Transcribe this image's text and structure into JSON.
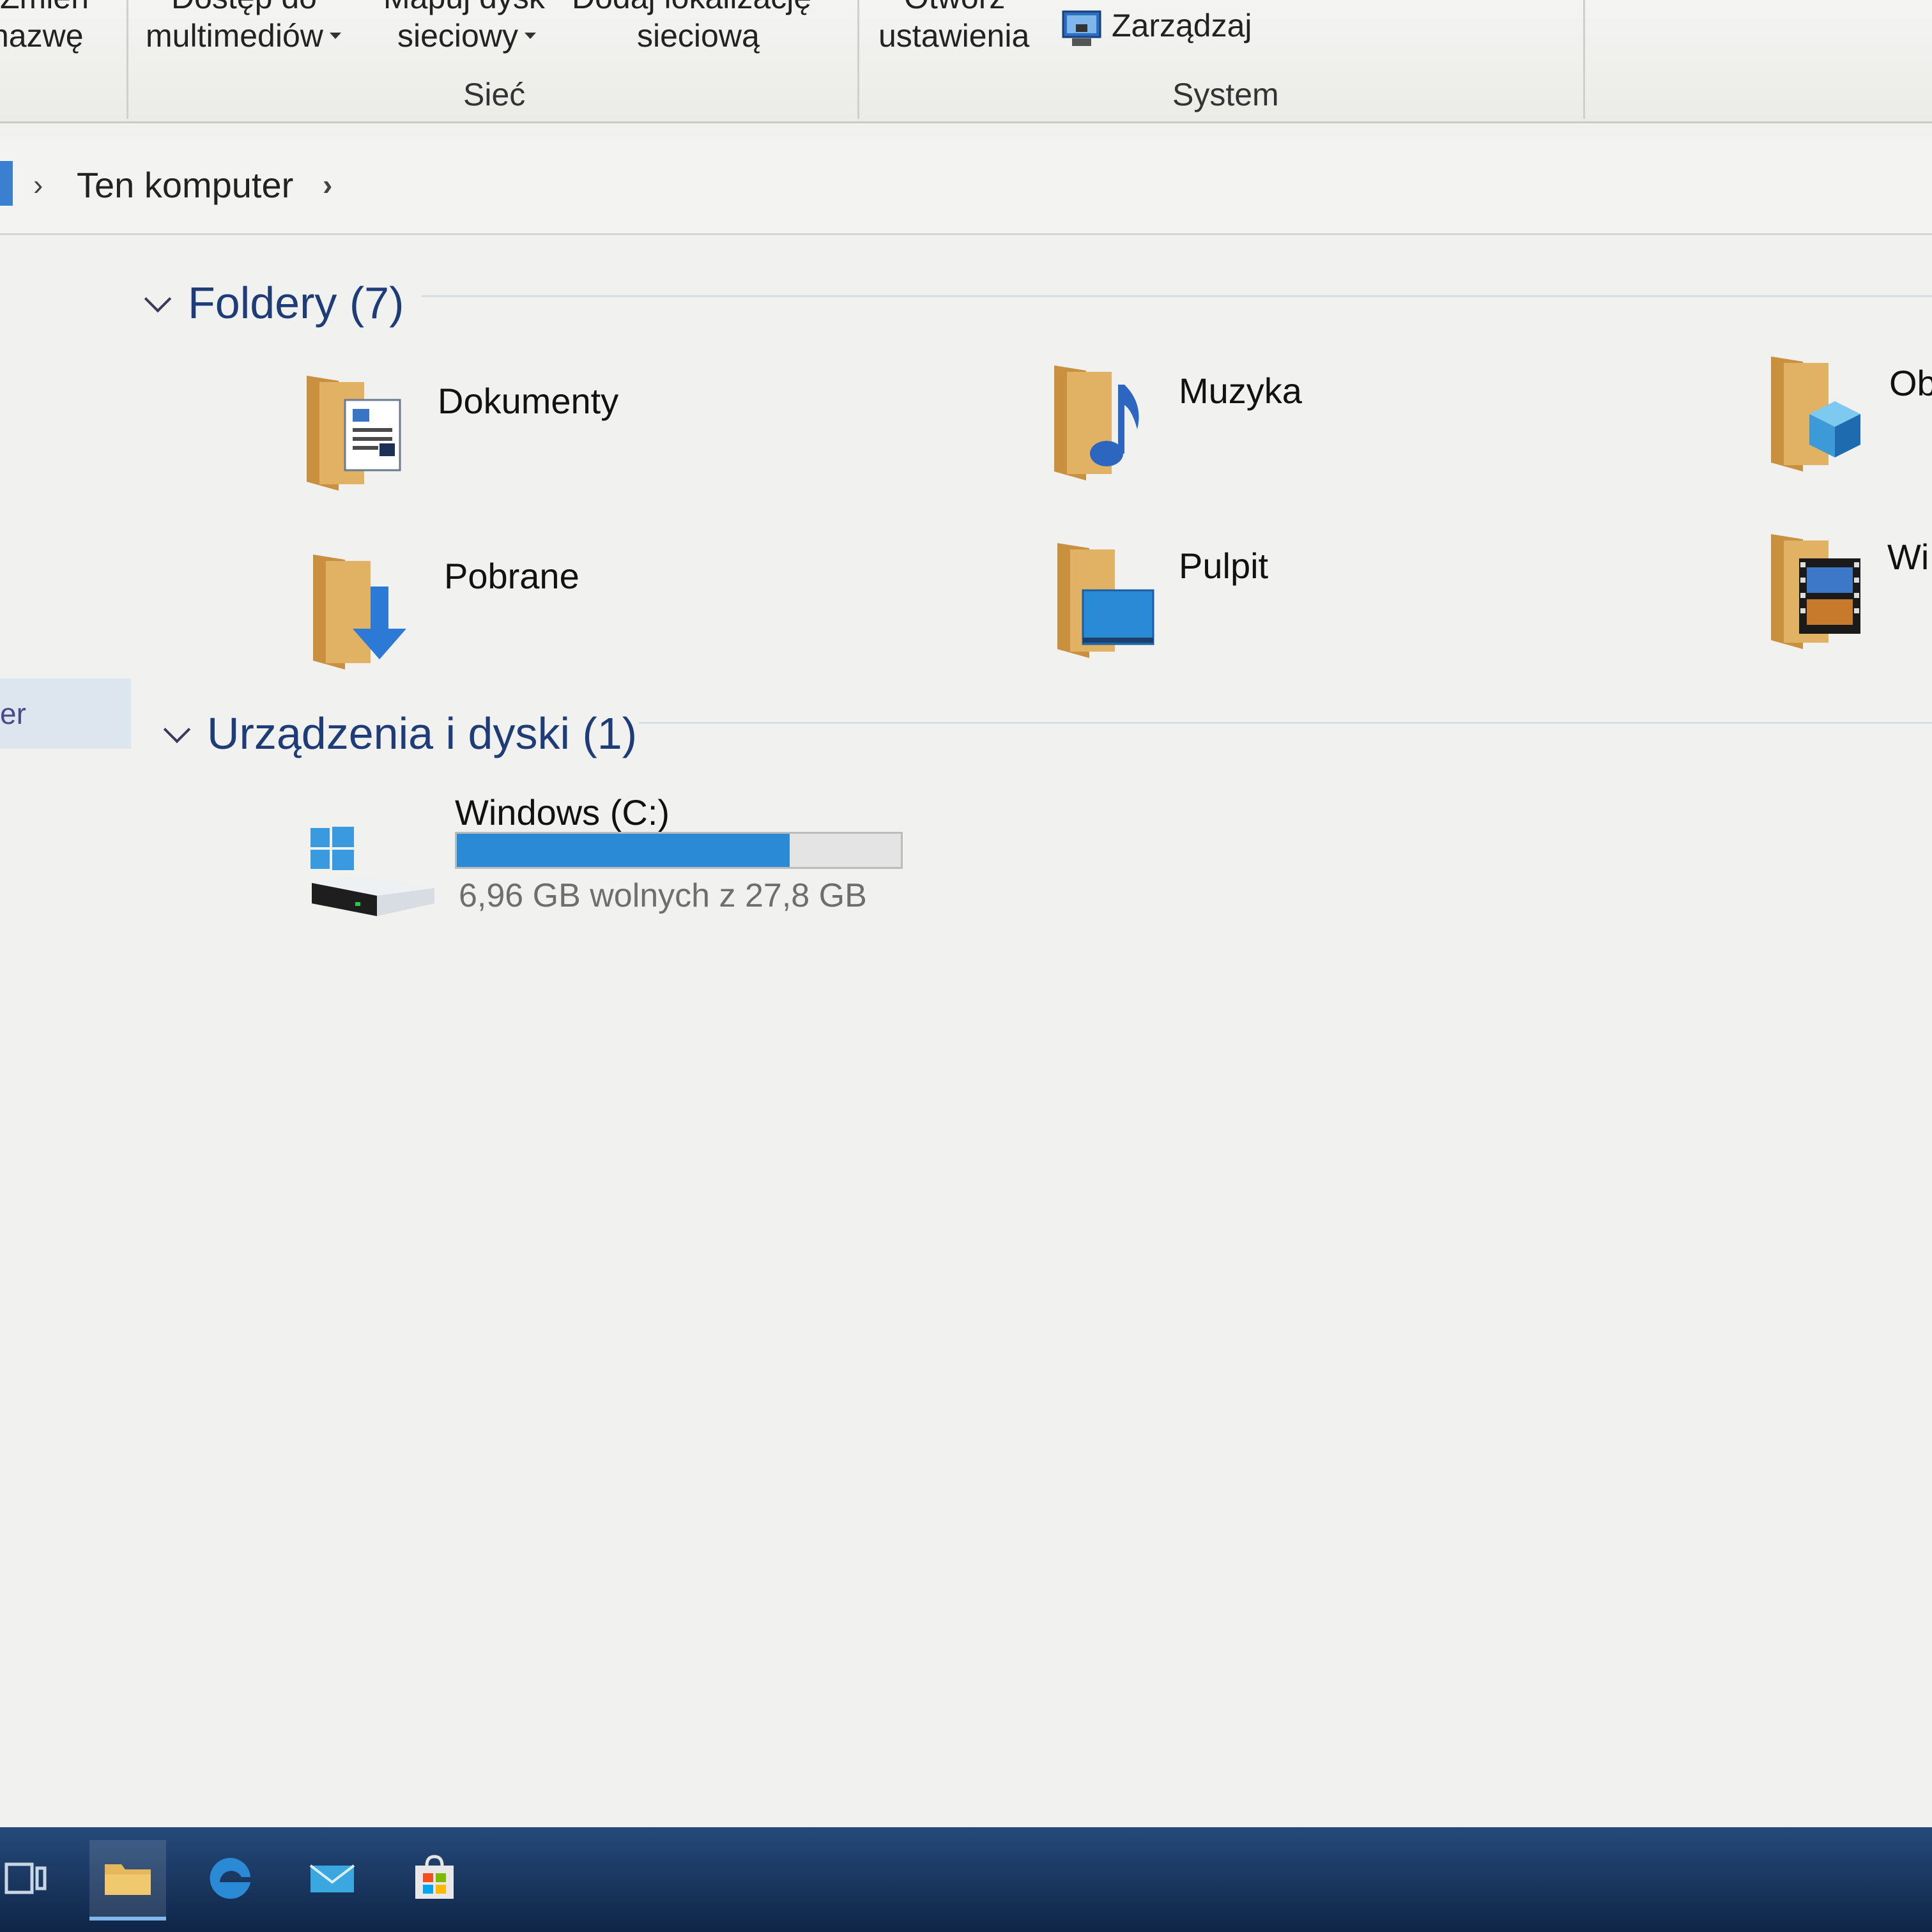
{
  "ribbon": {
    "rename_line1": "Zmień",
    "rename_line2": "nazwę",
    "media_access_line1": "Dostęp do",
    "media_access_line2": "multimediów",
    "map_drive_line1": "Mapuj dysk",
    "map_drive_line2": "sieciowy",
    "add_location_line1": "Dodaj lokalizację",
    "add_location_line2": "sieciową",
    "network_group": "Sieć",
    "open_settings_line1": "Otwórz",
    "open_settings_line2": "ustawienia",
    "manage": "Zarządzaj",
    "system_group": "System"
  },
  "address": {
    "path": "Ten komputer"
  },
  "nav": {
    "selected_fragment": "er"
  },
  "folders_group": {
    "title": "Foldery (7)",
    "items": [
      {
        "label": "Dokumenty",
        "icon": "documents-folder-icon"
      },
      {
        "label": "Muzyka",
        "icon": "music-folder-icon"
      },
      {
        "label": "Ob",
        "icon": "3d-objects-folder-icon"
      },
      {
        "label": "Pobrane",
        "icon": "downloads-folder-icon"
      },
      {
        "label": "Pulpit",
        "icon": "desktop-folder-icon"
      },
      {
        "label": "Wi",
        "icon": "videos-folder-icon"
      }
    ]
  },
  "devices_group": {
    "title": "Urządzenia i dyski (1)",
    "drive": {
      "label": "Windows (C:)",
      "status": "6,96 GB wolnych z 27,8 GB",
      "used_fraction": 0.75,
      "icon": "windows-drive-icon"
    }
  },
  "taskbar": {
    "items": [
      "task-view-icon",
      "file-explorer-icon",
      "edge-icon",
      "mail-icon",
      "store-icon"
    ]
  },
  "colors": {
    "accent": "#2a8ad6",
    "group_title": "#1e3d78",
    "taskbar": "#163566",
    "folder": "#d9a85c"
  }
}
